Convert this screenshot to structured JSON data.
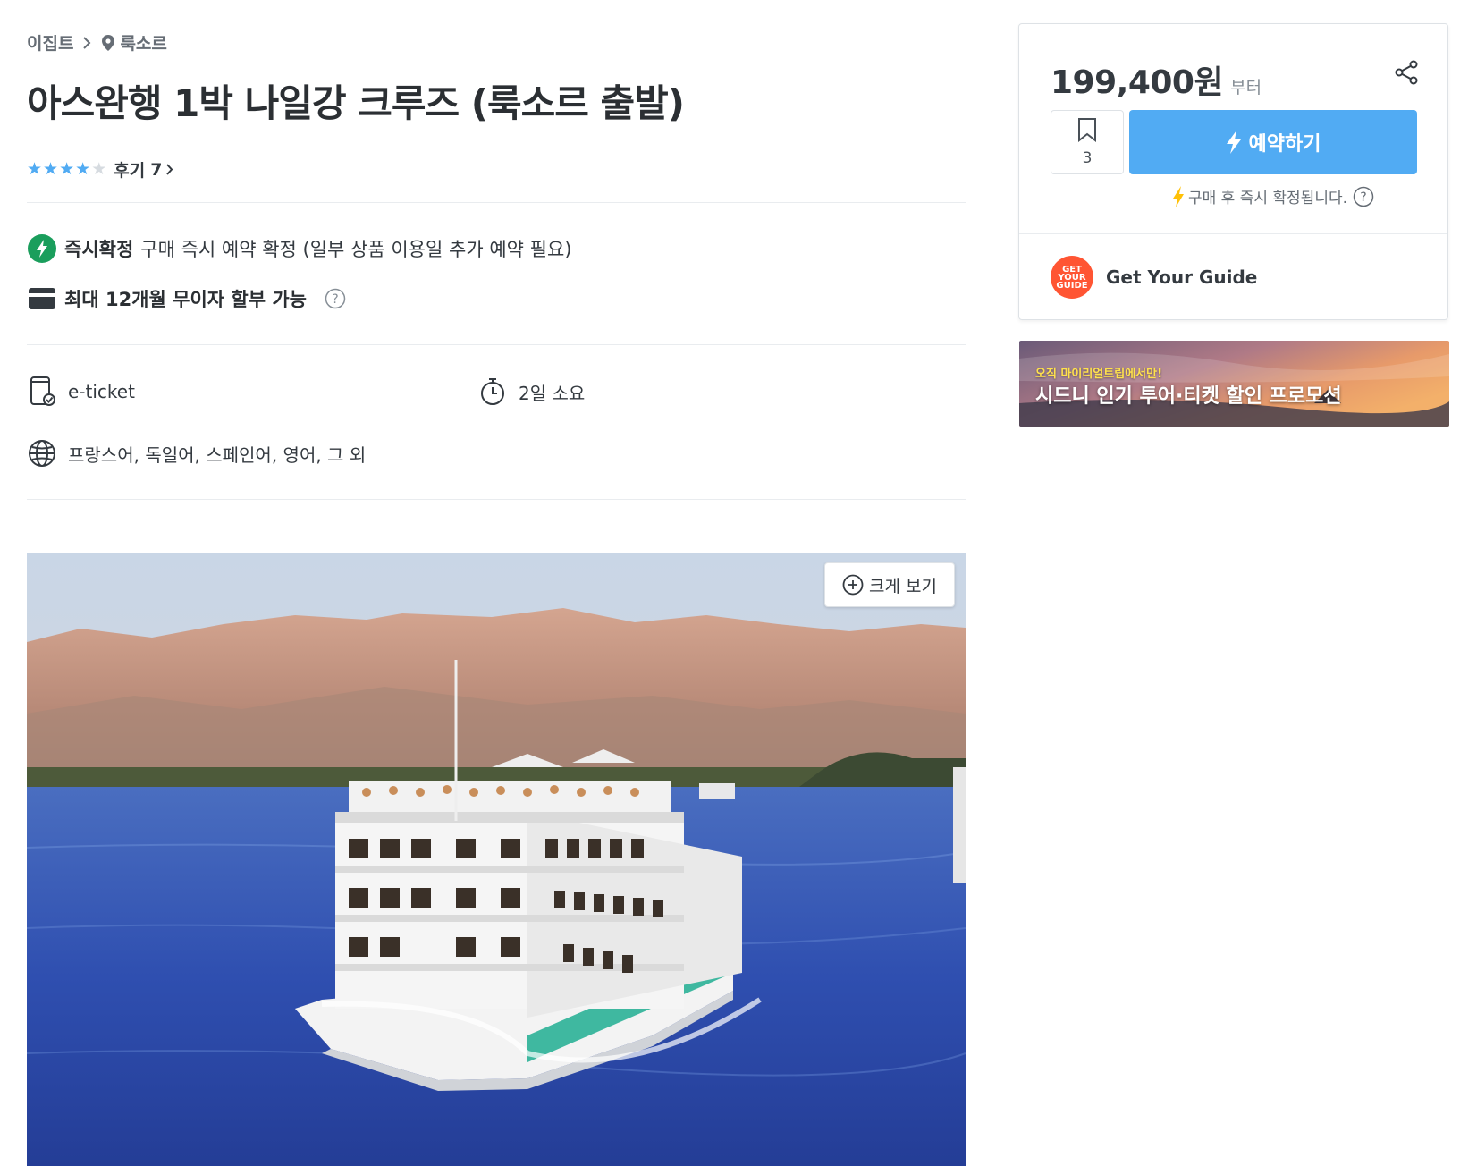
{
  "breadcrumb": {
    "country": "이집트",
    "city": "룩소르"
  },
  "title": "아스완행 1박 나일강 크루즈 (룩소르 출발)",
  "rating": {
    "stars_filled": 4,
    "stars_total": 5,
    "review_label": "후기",
    "review_count": "7"
  },
  "features": {
    "instant_title": "즉시확정",
    "instant_desc": "구매 즉시 예약 확정 (일부 상품 이용일 추가 예약 필요)",
    "installment": "최대 12개월 무이자 할부 가능"
  },
  "info": {
    "ticket": "e-ticket",
    "duration": "2일 소요",
    "languages": "프랑스어, 독일어, 스페인어, 영어, 그 외"
  },
  "hero": {
    "zoom_label": "크게 보기"
  },
  "booking": {
    "price": "199,400원",
    "price_suffix": "부터",
    "wishlist_count": "3",
    "book_label": "예약하기",
    "instant_note": "구매 후 즉시 확정됩니다.",
    "supplier_name": "Get Your Guide",
    "supplier_logo_lines": [
      "GET",
      "YOUR",
      "GUIDE"
    ]
  },
  "promo": {
    "subtitle": "오직 마이리얼트립에서만!",
    "headline": "시드니 인기 투어·티켓 할인 프로모션"
  },
  "colors": {
    "accent": "#51abf3",
    "instant_green": "#1a9e5c",
    "bolt_yellow": "#ffc107",
    "supplier_orange": "#ff5533"
  },
  "icons": [
    "chevron-right-icon",
    "location-pin-icon",
    "bolt-icon",
    "card-icon",
    "help-icon",
    "eticket-icon",
    "timer-icon",
    "globe-icon",
    "zoom-plus-icon",
    "share-icon",
    "bookmark-icon"
  ]
}
